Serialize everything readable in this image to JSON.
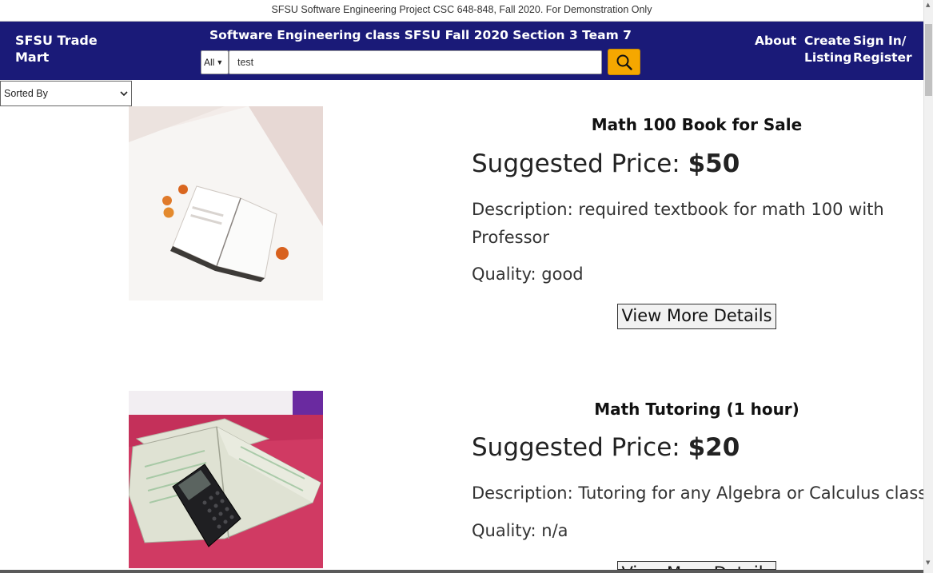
{
  "banner": {
    "text": "SFSU Software Engineering Project CSC 648-848, Fall 2020. For Demonstration Only"
  },
  "header": {
    "brand": "SFSU Trade Mart",
    "title": "Software Engineering class SFSU Fall 2020 Section 3 Team 7",
    "category_value": "All",
    "search_value": "test",
    "search_icon": "search-icon",
    "links": {
      "about": "About",
      "create_listing": "Create Listing",
      "sign_in": "Sign In/ Register"
    }
  },
  "sort": {
    "label": "Sorted By"
  },
  "listings": [
    {
      "title": "Math 100 Book for Sale",
      "price_label": "Suggested Price: ",
      "price": "$50",
      "description": "Description: required textbook for math 100 with Professor",
      "quality": "Quality: good",
      "button": "View More Details"
    },
    {
      "title": "Math Tutoring (1 hour)",
      "price_label": "Suggested Price: ",
      "price": "$20",
      "description": "Description: Tutoring for any Algebra or Calculus class",
      "quality": "Quality: n/a",
      "button": "View More Details"
    }
  ],
  "colors": {
    "navbar": "#1a1a78",
    "search_button": "#f5a700"
  }
}
